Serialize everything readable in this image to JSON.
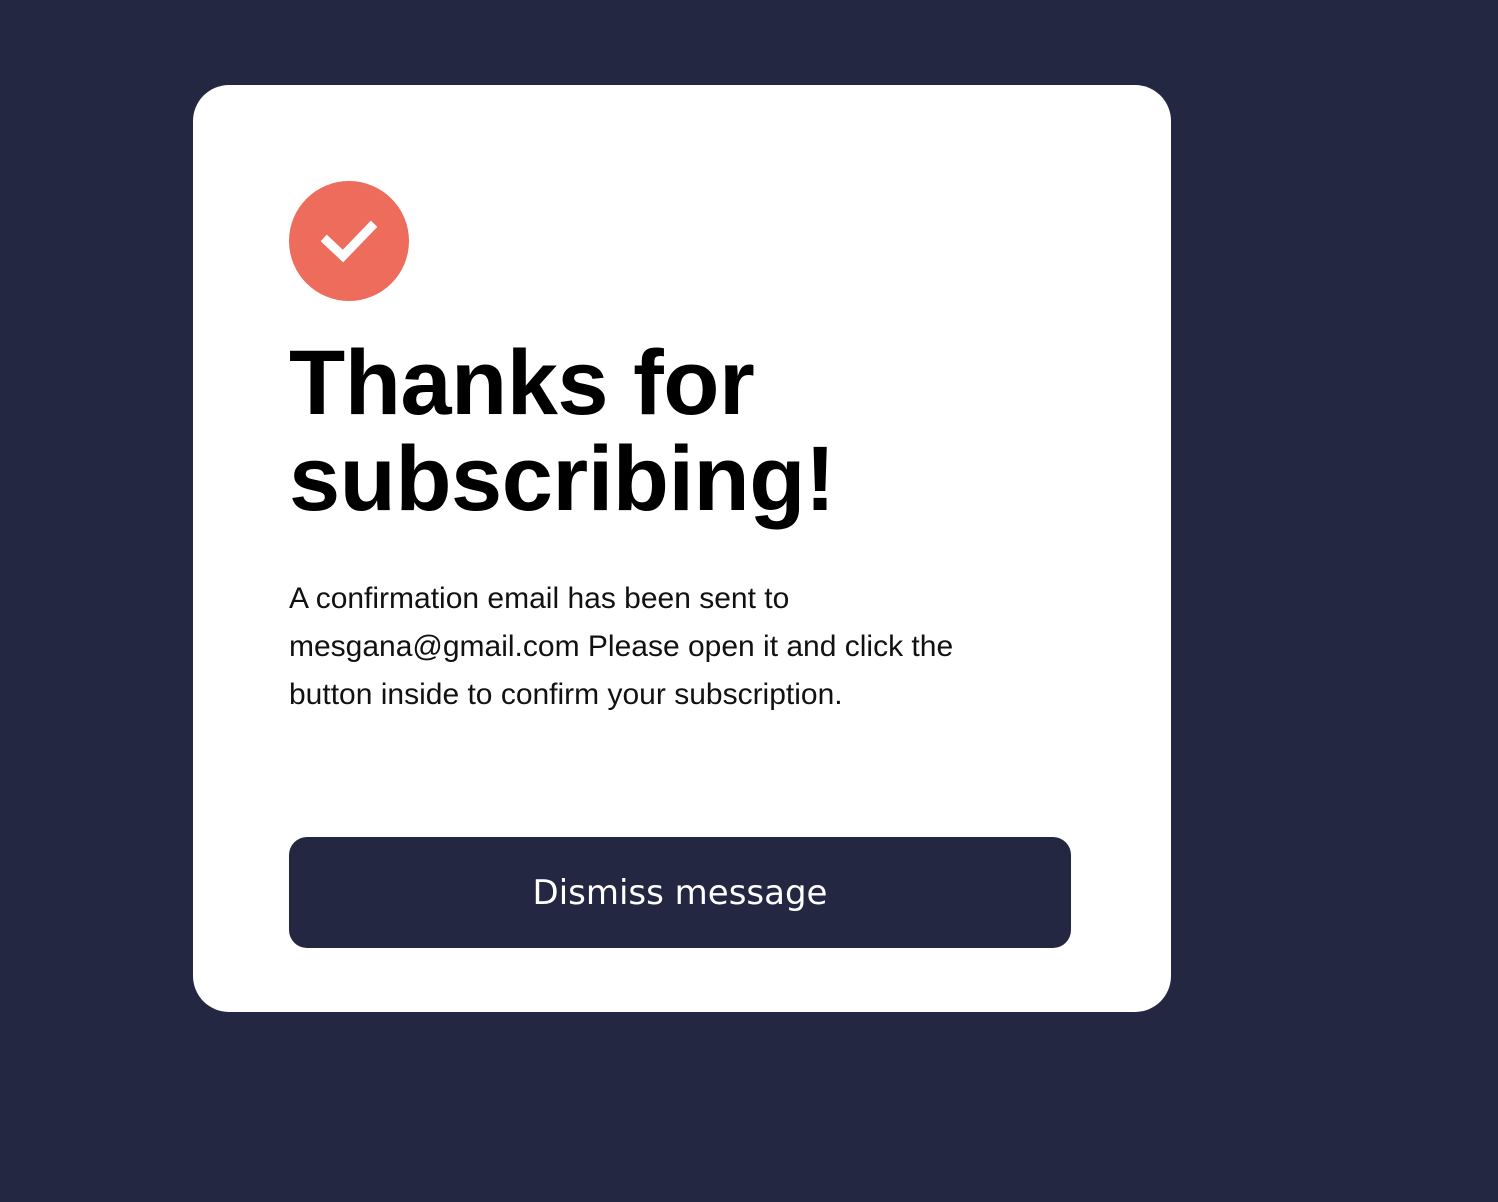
{
  "colors": {
    "page_background": "#242742",
    "card_background": "#ffffff",
    "accent": "#ee6c5c",
    "button_background": "#242742",
    "button_text": "#ffffff"
  },
  "icon": {
    "name": "checkmark-icon"
  },
  "confirmation": {
    "title_line1": "Thanks for",
    "title_line2": "subscribing!",
    "message": "A confirmation email has been sent to mesgana@gmail.com Please open it and click the button inside to confirm your subscription.",
    "dismiss_label": "Dismiss message"
  }
}
